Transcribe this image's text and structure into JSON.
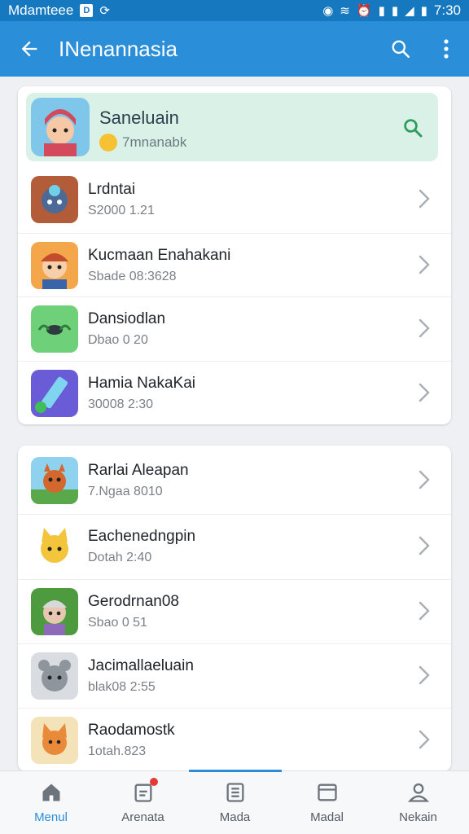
{
  "status_bar": {
    "carrier": "Mdamteee",
    "time": "7:30"
  },
  "app_bar": {
    "title": "INenannasia",
    "back_icon": "arrow-left-icon",
    "search_icon": "search-icon",
    "menu_icon": "more-vert-icon"
  },
  "featured": {
    "name": "Saneluain",
    "subtitle": "7mnanabk"
  },
  "list1": [
    {
      "name": "Lrdntai",
      "sub": "S2000 1.21"
    },
    {
      "name": "Kucmaan Enahakani",
      "sub": "Sbade 08:3628"
    },
    {
      "name": "Dansiodlan",
      "sub": "Dbao 0 20"
    },
    {
      "name": "Hamia NakaKai",
      "sub": "30008 2:30"
    }
  ],
  "list2": [
    {
      "name": "Rarlai Aleapan",
      "sub": "7.Ngaa 8010"
    },
    {
      "name": "Eachenedngpin",
      "sub": "Dotah 2:40"
    },
    {
      "name": "Gerodrnan08",
      "sub": "Sbao 0 51"
    },
    {
      "name": "Jacimallaeluain",
      "sub": "blak08 2:55"
    },
    {
      "name": "Raodamostk",
      "sub": "1otah.823"
    }
  ],
  "bottom_nav": [
    {
      "label": "Menul",
      "icon": "home-icon"
    },
    {
      "label": "Arenata",
      "icon": "notification-icon"
    },
    {
      "label": "Mada",
      "icon": "list-icon"
    },
    {
      "label": "Madal",
      "icon": "window-icon"
    },
    {
      "label": "Nekain",
      "icon": "profile-icon"
    }
  ],
  "colors": {
    "status_bar": "#1678bf",
    "app_bar": "#2b8ed8",
    "featured_bg": "#d9f1e6",
    "accent": "#2b8ed8",
    "badge": "#e53935"
  }
}
